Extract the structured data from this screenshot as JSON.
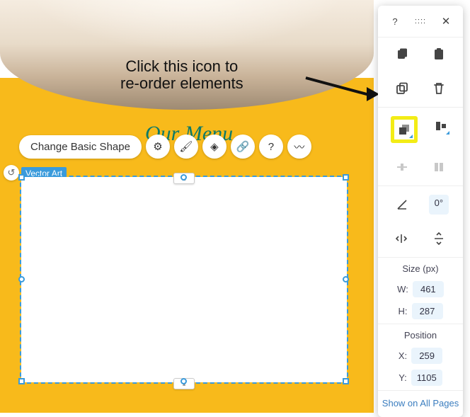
{
  "annotation": {
    "line1": "Click this icon to",
    "line2": "re-order elements"
  },
  "canvas": {
    "menu_title": "Our Menu",
    "selection_label": "Vector Art"
  },
  "toolbar": {
    "change_shape_label": "Change Basic Shape"
  },
  "panel": {
    "rotation": "0°",
    "size_title": "Size (px)",
    "width_label": "W:",
    "width_value": "461",
    "height_label": "H:",
    "height_value": "287",
    "position_title": "Position",
    "x_label": "X:",
    "x_value": "259",
    "y_label": "Y:",
    "y_value": "1105",
    "show_all_pages": "Show on All Pages"
  }
}
